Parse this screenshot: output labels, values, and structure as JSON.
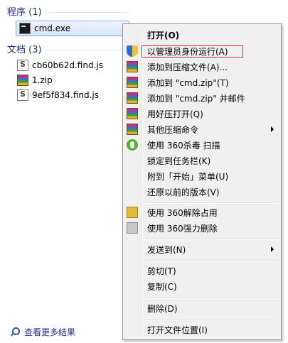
{
  "groups": {
    "programs": {
      "title": "程序 (1)",
      "items": [
        {
          "name": "cmd.exe",
          "icon": "cmd-icon"
        }
      ]
    },
    "documents": {
      "title": "文档 (3)",
      "items": [
        {
          "name": "cb60b62d.find.js",
          "icon": "script-file-icon"
        },
        {
          "name": "1.zip",
          "icon": "archive-icon"
        },
        {
          "name": "9ef5f834.find.js",
          "icon": "script-file-icon"
        }
      ]
    }
  },
  "more_results": "查看更多结果",
  "context_menu": {
    "items": [
      {
        "label": "打开(O)",
        "bold": true,
        "icon": null
      },
      {
        "label": "以管理员身份运行(A)",
        "icon": "uac-shield-icon"
      },
      {
        "label": "添加到压缩文件(A)...",
        "icon": "winrar-icon"
      },
      {
        "label": "添加到 \"cmd.zip\"(T)",
        "icon": "winrar-icon"
      },
      {
        "label": "添加到 \"cmd.zip\" 并邮件",
        "icon": "winrar-icon"
      },
      {
        "label": "用好压打开(Q)",
        "icon": "winrar-icon"
      },
      {
        "label": "其他压缩命令",
        "icon": "winrar-icon",
        "submenu": true
      },
      {
        "label": "使用 360杀毒 扫描",
        "icon": "360-antivirus-icon"
      },
      {
        "label": "锁定到任务栏(K)",
        "icon": null
      },
      {
        "label": "附到「开始」菜单(U)",
        "icon": null
      },
      {
        "label": "还原以前的版本(V)",
        "icon": null
      },
      {
        "label": "使用 360解除占用",
        "icon": "360-unlock-icon"
      },
      {
        "label": "使用 360强力删除",
        "icon": "360-shred-icon"
      },
      {
        "label": "发送到(N)",
        "icon": null,
        "submenu": true
      },
      {
        "label": "剪切(T)",
        "icon": null
      },
      {
        "label": "复制(C)",
        "icon": null
      },
      {
        "label": "删除(D)",
        "icon": null
      },
      {
        "label": "打开文件位置(I)",
        "icon": null
      }
    ]
  },
  "colors": {
    "group_title": "#1e3287",
    "highlight_border": "#e0232b",
    "menu_bg": "#f0f0f0"
  }
}
